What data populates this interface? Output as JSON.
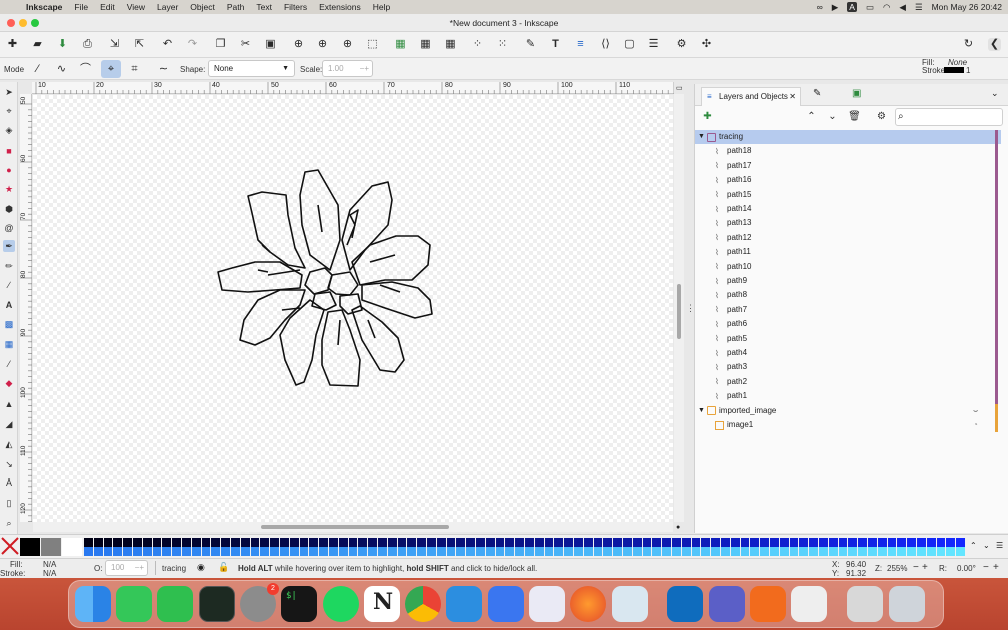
{
  "menubar": {
    "app_name": "Inkscape",
    "items": [
      "File",
      "Edit",
      "View",
      "Layer",
      "Object",
      "Path",
      "Text",
      "Filters",
      "Extensions",
      "Help"
    ],
    "clock": "Mon May 26  20:42"
  },
  "window": {
    "title": "*New document 3 - Inkscape"
  },
  "style_indicator": {
    "fill_label": "Fill:",
    "fill_value": "None",
    "stroke_label": "Stroke:",
    "stroke_width": "1"
  },
  "tool_controls": {
    "mode_label": "Mode",
    "shape_label": "Shape:",
    "shape_value": "None",
    "scale_label": "Scale:",
    "scale_value": "1.00"
  },
  "ruler": {
    "h_ticks": [
      "10",
      "20",
      "30",
      "40",
      "50",
      "60",
      "70",
      "80",
      "90",
      "100",
      "110"
    ],
    "v_ticks": [
      "50",
      "60",
      "70",
      "80",
      "90",
      "100",
      "110",
      "120"
    ]
  },
  "panel": {
    "tab_label": "Layers and Objects",
    "layers": [
      {
        "name": "tracing",
        "color": "#9b5a8f",
        "children": [
          "path18",
          "path17",
          "path16",
          "path15",
          "path14",
          "path13",
          "path12",
          "path11",
          "path10",
          "path9",
          "path8",
          "path7",
          "path6",
          "path5",
          "path4",
          "path3",
          "path2",
          "path1"
        ]
      },
      {
        "name": "imported_image",
        "color": "#e8a33a",
        "children": [
          "image1"
        ]
      }
    ]
  },
  "statusbar": {
    "fill_label": "Fill:",
    "fill_value": "N/A",
    "stroke_label": "Stroke:",
    "stroke_value": "N/A",
    "opacity_label": "O:",
    "opacity_value": "100",
    "layer_name": "tracing",
    "hint_bold1": "Hold ALT",
    "hint_mid": " while hovering over item to highlight, ",
    "hint_bold2": "hold SHIFT",
    "hint_end": " and click to hide/lock all.",
    "x_label": "X:",
    "x_value": "96.40",
    "y_label": "Y:",
    "y_value": "91.32",
    "zoom_label": "Z:",
    "zoom_value": "255%",
    "rotation_label": "R:",
    "rotation_value": "0.00°"
  },
  "dock": {
    "spotify_badge": "",
    "system_prefs_badge": "2"
  }
}
